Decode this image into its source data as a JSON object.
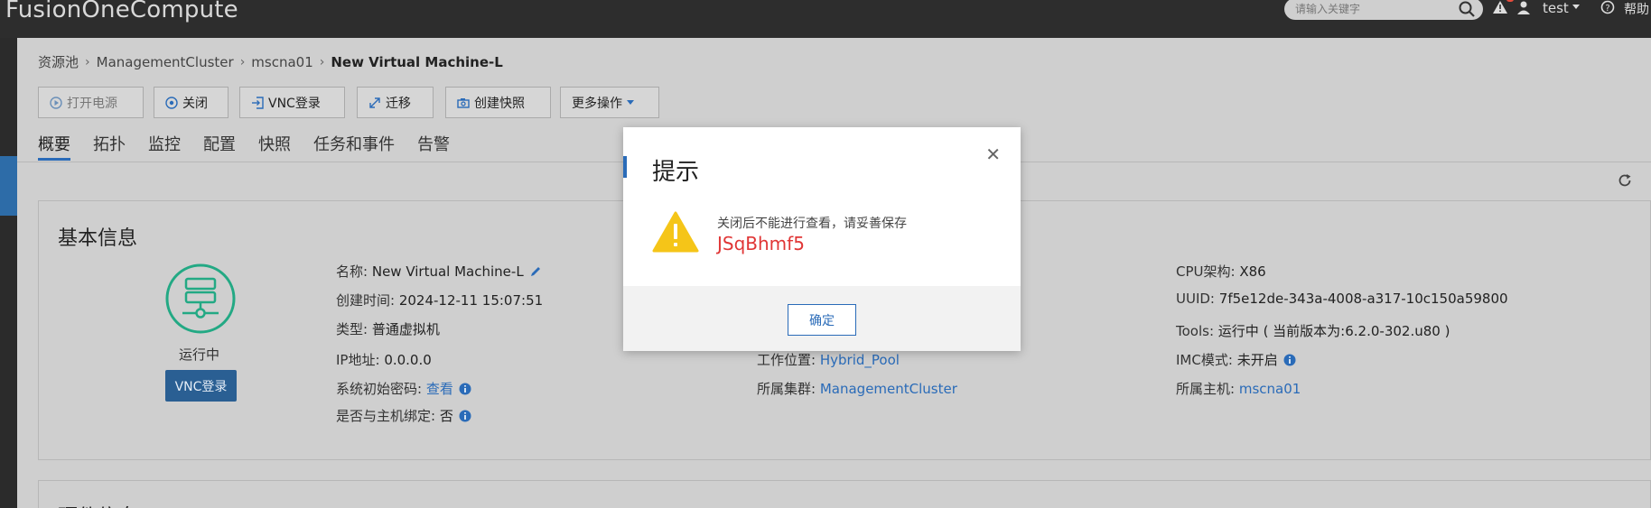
{
  "app": {
    "title": "FusionOneCompute"
  },
  "topbar": {
    "search_placeholder": "请输入关键字",
    "user": "test",
    "help": "帮助"
  },
  "breadcrumb": [
    "资源池",
    "ManagementCluster",
    "mscna01",
    "New Virtual Machine-L"
  ],
  "toolbar": {
    "power_on": "打开电源",
    "shutdown": "关闭",
    "vnc_login": "VNC登录",
    "migrate": "迁移",
    "snapshot": "创建快照",
    "more": "更多操作"
  },
  "tabs": [
    "概要",
    "拓扑",
    "监控",
    "配置",
    "快照",
    "任务和事件",
    "告警"
  ],
  "basic_info": {
    "title": "基本信息",
    "status": "运行中",
    "vnc_button": "VNC登录",
    "name_label": "名称:",
    "name_value": "New Virtual Machine-L",
    "created_label": "创建时间:",
    "created_value": "2024-12-11 15:07:51",
    "type_label": "类型:",
    "type_value": "普通虚拟机",
    "ip_label": "IP地址:",
    "ip_value": "0.0.0.0",
    "init_pwd_label": "系统初始密码:",
    "init_pwd_link": "查看",
    "bind_label": "是否与主机绑定:",
    "bind_value": "否",
    "location_label": "工作位置:",
    "location_value": "Hybrid_Pool",
    "cluster_label": "所属集群:",
    "cluster_value": "ManagementCluster",
    "cpu_arch_label": "CPU架构:",
    "cpu_arch_value": "X86",
    "uuid_label": "UUID:",
    "uuid_value": "7f5e12de-343a-4008-a317-10c150a59800",
    "tools_label": "Tools:",
    "tools_value": "运行中 ( 当前版本为:6.2.0-302.u80 )",
    "imc_label": "IMC模式:",
    "imc_value": "未开启",
    "host_label": "所属主机:",
    "host_value": "mscna01"
  },
  "hardware_info": {
    "title": "硬件信息"
  },
  "modal": {
    "title": "提示",
    "message": "关闭后不能进行查看，请妥善保存",
    "secret": "JSqBhmf5",
    "ok": "确定"
  },
  "colors": {
    "accent": "#2a6bb8",
    "warning": "#f5c518",
    "secret": "#e03636",
    "status": "#23a984"
  }
}
